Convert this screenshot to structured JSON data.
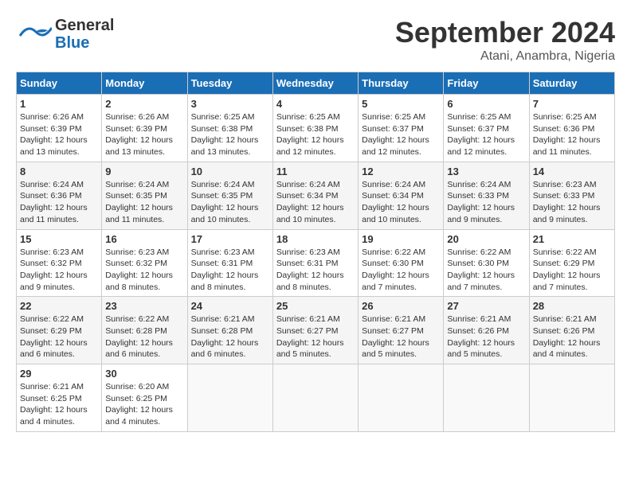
{
  "header": {
    "logo_line1": "General",
    "logo_line2": "Blue",
    "month": "September 2024",
    "location": "Atani, Anambra, Nigeria"
  },
  "weekdays": [
    "Sunday",
    "Monday",
    "Tuesday",
    "Wednesday",
    "Thursday",
    "Friday",
    "Saturday"
  ],
  "weeks": [
    [
      {
        "day": "1",
        "info": "Sunrise: 6:26 AM\nSunset: 6:39 PM\nDaylight: 12 hours\nand 13 minutes."
      },
      {
        "day": "2",
        "info": "Sunrise: 6:26 AM\nSunset: 6:39 PM\nDaylight: 12 hours\nand 13 minutes."
      },
      {
        "day": "3",
        "info": "Sunrise: 6:25 AM\nSunset: 6:38 PM\nDaylight: 12 hours\nand 13 minutes."
      },
      {
        "day": "4",
        "info": "Sunrise: 6:25 AM\nSunset: 6:38 PM\nDaylight: 12 hours\nand 12 minutes."
      },
      {
        "day": "5",
        "info": "Sunrise: 6:25 AM\nSunset: 6:37 PM\nDaylight: 12 hours\nand 12 minutes."
      },
      {
        "day": "6",
        "info": "Sunrise: 6:25 AM\nSunset: 6:37 PM\nDaylight: 12 hours\nand 12 minutes."
      },
      {
        "day": "7",
        "info": "Sunrise: 6:25 AM\nSunset: 6:36 PM\nDaylight: 12 hours\nand 11 minutes."
      }
    ],
    [
      {
        "day": "8",
        "info": "Sunrise: 6:24 AM\nSunset: 6:36 PM\nDaylight: 12 hours\nand 11 minutes."
      },
      {
        "day": "9",
        "info": "Sunrise: 6:24 AM\nSunset: 6:35 PM\nDaylight: 12 hours\nand 11 minutes."
      },
      {
        "day": "10",
        "info": "Sunrise: 6:24 AM\nSunset: 6:35 PM\nDaylight: 12 hours\nand 10 minutes."
      },
      {
        "day": "11",
        "info": "Sunrise: 6:24 AM\nSunset: 6:34 PM\nDaylight: 12 hours\nand 10 minutes."
      },
      {
        "day": "12",
        "info": "Sunrise: 6:24 AM\nSunset: 6:34 PM\nDaylight: 12 hours\nand 10 minutes."
      },
      {
        "day": "13",
        "info": "Sunrise: 6:24 AM\nSunset: 6:33 PM\nDaylight: 12 hours\nand 9 minutes."
      },
      {
        "day": "14",
        "info": "Sunrise: 6:23 AM\nSunset: 6:33 PM\nDaylight: 12 hours\nand 9 minutes."
      }
    ],
    [
      {
        "day": "15",
        "info": "Sunrise: 6:23 AM\nSunset: 6:32 PM\nDaylight: 12 hours\nand 9 minutes."
      },
      {
        "day": "16",
        "info": "Sunrise: 6:23 AM\nSunset: 6:32 PM\nDaylight: 12 hours\nand 8 minutes."
      },
      {
        "day": "17",
        "info": "Sunrise: 6:23 AM\nSunset: 6:31 PM\nDaylight: 12 hours\nand 8 minutes."
      },
      {
        "day": "18",
        "info": "Sunrise: 6:23 AM\nSunset: 6:31 PM\nDaylight: 12 hours\nand 8 minutes."
      },
      {
        "day": "19",
        "info": "Sunrise: 6:22 AM\nSunset: 6:30 PM\nDaylight: 12 hours\nand 7 minutes."
      },
      {
        "day": "20",
        "info": "Sunrise: 6:22 AM\nSunset: 6:30 PM\nDaylight: 12 hours\nand 7 minutes."
      },
      {
        "day": "21",
        "info": "Sunrise: 6:22 AM\nSunset: 6:29 PM\nDaylight: 12 hours\nand 7 minutes."
      }
    ],
    [
      {
        "day": "22",
        "info": "Sunrise: 6:22 AM\nSunset: 6:29 PM\nDaylight: 12 hours\nand 6 minutes."
      },
      {
        "day": "23",
        "info": "Sunrise: 6:22 AM\nSunset: 6:28 PM\nDaylight: 12 hours\nand 6 minutes."
      },
      {
        "day": "24",
        "info": "Sunrise: 6:21 AM\nSunset: 6:28 PM\nDaylight: 12 hours\nand 6 minutes."
      },
      {
        "day": "25",
        "info": "Sunrise: 6:21 AM\nSunset: 6:27 PM\nDaylight: 12 hours\nand 5 minutes."
      },
      {
        "day": "26",
        "info": "Sunrise: 6:21 AM\nSunset: 6:27 PM\nDaylight: 12 hours\nand 5 minutes."
      },
      {
        "day": "27",
        "info": "Sunrise: 6:21 AM\nSunset: 6:26 PM\nDaylight: 12 hours\nand 5 minutes."
      },
      {
        "day": "28",
        "info": "Sunrise: 6:21 AM\nSunset: 6:26 PM\nDaylight: 12 hours\nand 4 minutes."
      }
    ],
    [
      {
        "day": "29",
        "info": "Sunrise: 6:21 AM\nSunset: 6:25 PM\nDaylight: 12 hours\nand 4 minutes."
      },
      {
        "day": "30",
        "info": "Sunrise: 6:20 AM\nSunset: 6:25 PM\nDaylight: 12 hours\nand 4 minutes."
      },
      {
        "day": "",
        "info": ""
      },
      {
        "day": "",
        "info": ""
      },
      {
        "day": "",
        "info": ""
      },
      {
        "day": "",
        "info": ""
      },
      {
        "day": "",
        "info": ""
      }
    ]
  ]
}
